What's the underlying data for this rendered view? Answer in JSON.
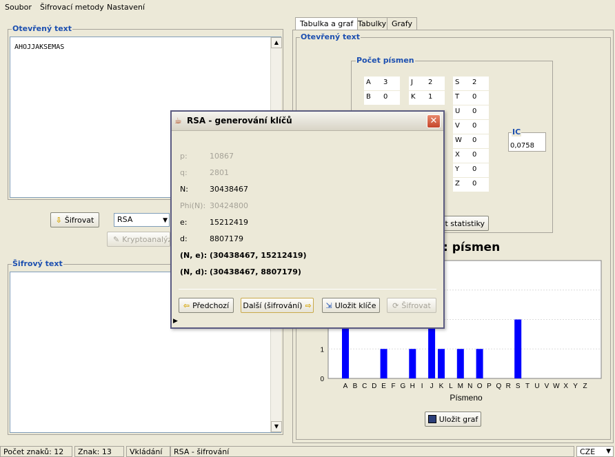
{
  "menubar": {
    "items": [
      {
        "label": "Soubor"
      },
      {
        "label": "Šifrovací metody"
      },
      {
        "label": "Nastavení"
      }
    ]
  },
  "left": {
    "plaintext_legend": "Otevřený text",
    "plaintext_value": "AHOJJAKSEMAS",
    "encrypt_button": "Šifrovat",
    "method_select": "RSA",
    "cryptanalysis_button": "Kryptoanalýza",
    "ciphertext_legend": "Šifrový text",
    "ciphertext_value": ""
  },
  "right": {
    "tabs": [
      {
        "label": "Tabulka a graf"
      },
      {
        "label": "Tabulky"
      },
      {
        "label": "Grafy"
      }
    ],
    "panel_legend": "Otevřený text",
    "letter_count_legend": "Počet písmen",
    "letter_columns": [
      [
        [
          "A",
          "3"
        ],
        [
          "B",
          "0"
        ]
      ],
      [
        [
          "J",
          "2"
        ],
        [
          "K",
          "1"
        ]
      ],
      [
        [
          "S",
          "2"
        ],
        [
          "T",
          "0"
        ],
        [
          "U",
          "0"
        ],
        [
          "V",
          "0"
        ],
        [
          "W",
          "0"
        ],
        [
          "X",
          "0"
        ],
        [
          "Y",
          "0"
        ],
        [
          "Z",
          "0"
        ]
      ]
    ],
    "ic_legend": "IC",
    "ic_value": "0,0758",
    "save_stats_button": "Uložit statistiky",
    "chart_title_visible": ": písmen",
    "save_graph_button": "Uložit graf"
  },
  "chart_data": {
    "type": "bar",
    "title": ": písmen",
    "xlabel": "Písmeno",
    "ylabel": "",
    "ylim": [
      0,
      4
    ],
    "categories": [
      "A",
      "B",
      "C",
      "D",
      "E",
      "F",
      "G",
      "H",
      "I",
      "J",
      "K",
      "L",
      "M",
      "N",
      "O",
      "P",
      "Q",
      "R",
      "S",
      "T",
      "U",
      "V",
      "W",
      "X",
      "Y",
      "Z"
    ],
    "values": [
      3,
      0,
      0,
      0,
      1,
      0,
      0,
      1,
      0,
      2,
      1,
      0,
      1,
      0,
      1,
      0,
      0,
      0,
      2,
      0,
      0,
      0,
      0,
      0,
      0,
      0
    ],
    "visible_ytick_labels": [
      "0",
      "1"
    ],
    "bar_color": "#0000ff"
  },
  "dialog": {
    "title": "RSA - generování klíčů",
    "rows": [
      {
        "label": "p:",
        "value": "10867",
        "muted": true
      },
      {
        "label": "q:",
        "value": "2801",
        "muted": true
      },
      {
        "label": "N:",
        "value": "30438467",
        "muted": false
      },
      {
        "label": "Phi(N):",
        "value": "30424800",
        "muted": true
      },
      {
        "label": "e:",
        "value": "15212419",
        "muted": false
      },
      {
        "label": "d:",
        "value": "8807179",
        "muted": false
      },
      {
        "label": "(N, e):",
        "value": "(30438467, 15212419)",
        "bold": true
      },
      {
        "label": "(N, d):",
        "value": "(30438467, 8807179)",
        "bold": true
      }
    ],
    "prev_button": "Předchozí",
    "next_button": "Další (šifrování)",
    "save_keys_button": "Uložit klíče",
    "encrypt_button": "Šifrovat"
  },
  "statusbar": {
    "char_count": "Počet znaků: 12",
    "char": "Znak: 13",
    "mode": "Vkládání",
    "cipher": "RSA - šifrování",
    "language": "CZE"
  },
  "colors": {
    "accent": "#1c4fb0",
    "bar": "#0000ff",
    "window_bg": "#ece9d8"
  }
}
